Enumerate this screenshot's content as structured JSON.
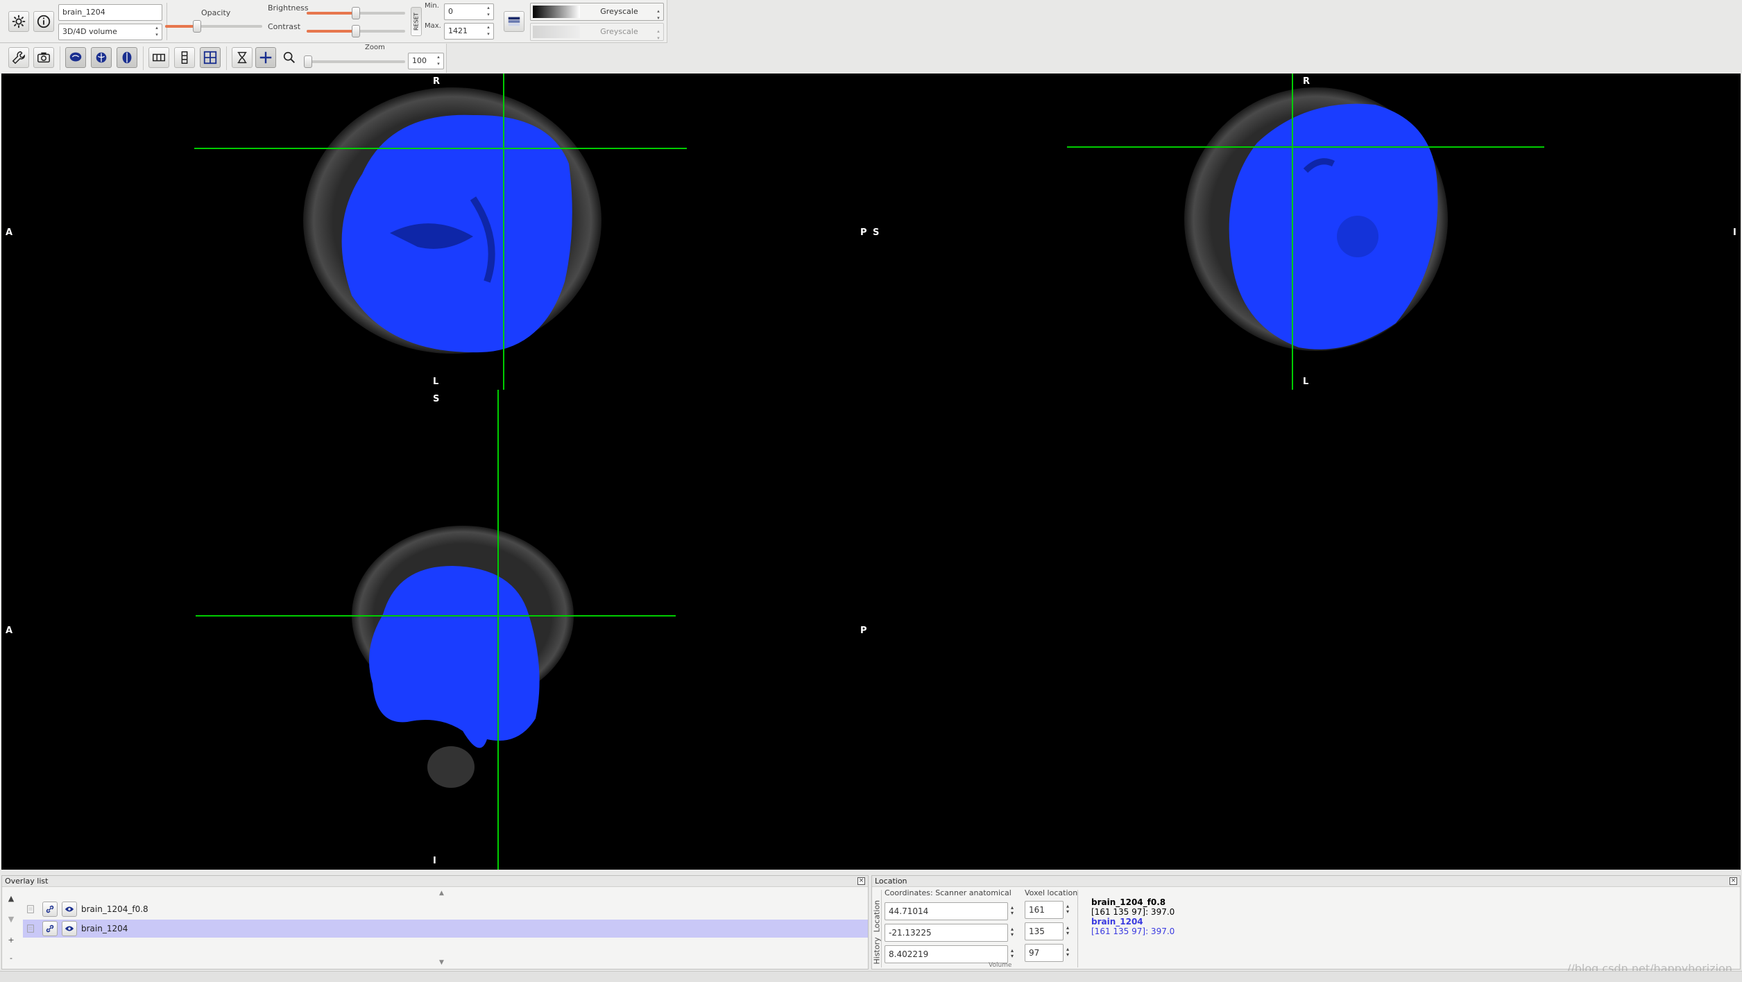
{
  "toolbar": {
    "settings_icon": "gear-icon",
    "info_icon": "info-icon",
    "overlay_name": "brain_1204",
    "overlay_type": "3D/4D volume",
    "opacity_label": "Opacity",
    "opacity_value": 0.33,
    "brightness_label": "Brightness",
    "brightness_value": 0.5,
    "contrast_label": "Contrast",
    "contrast_value": 0.5,
    "reset_label": "RESET",
    "min_label": "Min.",
    "min_value": "0",
    "max_label": "Max.",
    "max_value": "1421",
    "colormap_primary": "Greyscale",
    "colormap_secondary": "Greyscale",
    "zoom_label": "Zoom",
    "zoom_value": "100"
  },
  "viewer": {
    "crosshair_color": "#00cc00",
    "overlay_color": "#1a3dff",
    "axial": {
      "top": "R",
      "bottom": "L",
      "left": "A",
      "right": "P"
    },
    "coronal": {
      "top": "R",
      "bottom": "L",
      "left": "S",
      "right": "I"
    },
    "sagittal": {
      "top": "S",
      "bottom": "I",
      "left": "A",
      "right": "P"
    }
  },
  "overlay_list": {
    "title": "Overlay list",
    "items": [
      {
        "name": "brain_1204_f0.8",
        "selected": false
      },
      {
        "name": "brain_1204",
        "selected": true
      }
    ]
  },
  "location": {
    "title": "Location",
    "coords_label": "Coordinates: Scanner anatomical",
    "voxel_label": "Voxel location",
    "side_tabs": "History  Location",
    "x": "44.71014",
    "y": "-21.13225",
    "z": "8.402219",
    "vx": "161",
    "vy": "135",
    "vz": "97",
    "volume_label": "Volume",
    "info": [
      {
        "text": "brain_1204_f0.8",
        "color": "#000000",
        "bold": true
      },
      {
        "text": "[161 135 97]: 397.0",
        "color": "#000000",
        "bold": false
      },
      {
        "text": "brain_1204",
        "color": "#3a3ae0",
        "bold": true
      },
      {
        "text": "[161 135 97]: 397.0",
        "color": "#3a3ae0",
        "bold": false
      }
    ]
  },
  "watermark": "//blog.csdn.net/happyhorizion"
}
